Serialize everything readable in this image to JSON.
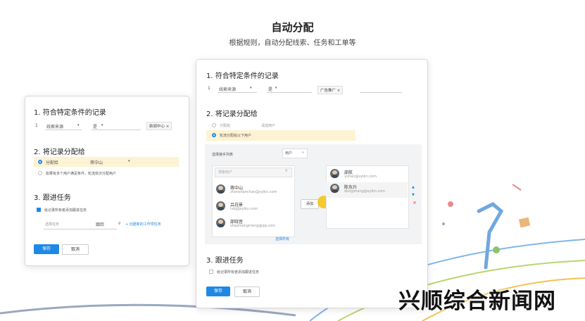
{
  "header": {
    "title": "自动分配",
    "subtitle": "根据规则，自动分配线索、任务和工单等"
  },
  "left_card": {
    "section1": "1.  符合特定条件的记录",
    "rule_num": "1",
    "rule_field": "线索来源",
    "rule_op": "是",
    "rule_value": "新闻中心",
    "section2": "2. 将记录分配给",
    "opt1_label": "分配给",
    "opt1_value": "蒋中山",
    "opt2_label": "如果有多个用户满足条件，轮流依次分配用户",
    "section3": "3.  跟进任务",
    "check_label": "给记录所有者添加跟进任务",
    "task_placeholder": "选择任务",
    "task_value": "跟踪",
    "task_link": "+ 创建新的工作项任务",
    "save": "保存",
    "cancel": "取消"
  },
  "main_card": {
    "section1": "1.  符合特定条件的记录",
    "rule_num": "1",
    "rule_field": "线索来源",
    "rule_op": "是",
    "rule_value": "广告推广",
    "section2": "2.  将记录分配给",
    "opt1_label": "分配给",
    "opt1_value": "请选用户",
    "opt2_label": "轮流分配给以下用户",
    "pick_label": "选择接手列表",
    "pick_select": "用户",
    "search_placeholder": "搜索用户",
    "left_users": [
      {
        "name": "蒋中山",
        "email": "zhonshanchan@sylkn.com"
      },
      {
        "name": "吕白景",
        "email": "lvbj@sylkn.com"
      },
      {
        "name": "邵晓音",
        "email": "shaomengmeng@qq.com"
      }
    ],
    "add_button": "添加",
    "select_all": "选择所有",
    "right_users": [
      {
        "name": "邵航",
        "email": "yuhan@sylkn.com"
      },
      {
        "name": "陈东升",
        "email": "dongsheng@sylkn.com"
      }
    ],
    "section3": "3.  跟进任务",
    "check_label": "给记录所有者添加跟进任务",
    "save": "保存",
    "cancel": "取消"
  },
  "watermark": "兴顺综合新闻网",
  "colors": {
    "accent": "#1e88e5",
    "highlight": "#fdf3d3",
    "cursor": "#f5c518"
  }
}
